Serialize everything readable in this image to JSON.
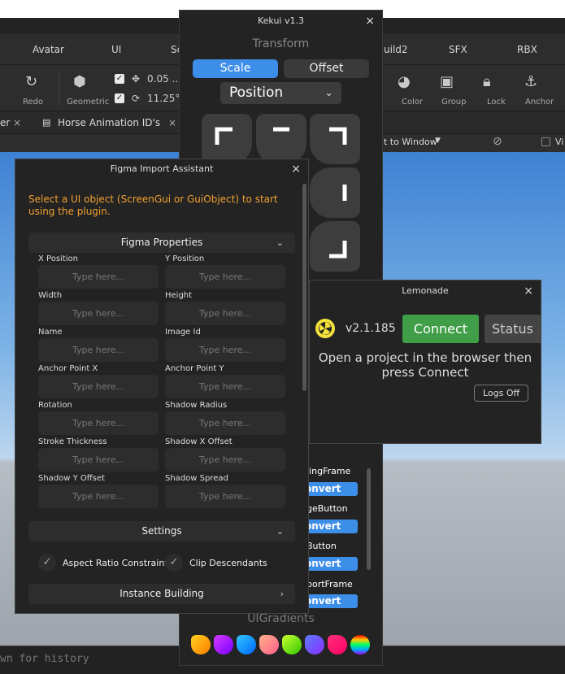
{
  "studio": {
    "tabs": [
      "Avatar",
      "UI",
      "Sc",
      "uild2",
      "SFX",
      "RBX"
    ],
    "ribbon": {
      "redo": "Redo",
      "geometric": "Geometric",
      "move_value": "0.05 ...",
      "rotate_value": "11.25°",
      "color": "Color",
      "group": "Group",
      "lock": "Lock",
      "anchor": "Anchor"
    },
    "doc_tabs": {
      "partial": "er",
      "horse": "Horse Animation ID's"
    },
    "view": {
      "fit": "t to Window",
      "vi": "Vi"
    },
    "command_placeholder": "wn for history"
  },
  "kekui": {
    "title": "Kekui v1.3",
    "transform_label": "Transform",
    "scale_label": "Scale",
    "offset_label": "Offset",
    "position_value": "Position",
    "list": [
      {
        "name": "lingFrame",
        "button": "onvert"
      },
      {
        "name": "geButton",
        "button": "onvert"
      },
      {
        "name": "Button",
        "button": "onvert"
      },
      {
        "name": "portFrame",
        "button": "onvert"
      }
    ],
    "uigradients_label": "UIGradients",
    "gradients": [
      "linear-gradient(135deg,#ffd21f,#ff7a00)",
      "linear-gradient(135deg,#d23bff,#7a00ff)",
      "linear-gradient(135deg,#30c8ff,#0066ff)",
      "linear-gradient(135deg,#ffb38a,#ff5c8a)",
      "linear-gradient(135deg,#c8ff30,#30c800)",
      "linear-gradient(135deg,#5a7bff,#8a30ff)",
      "linear-gradient(135deg,#ff3078,#ff0066)",
      "linear-gradient(180deg,#ff0000,#ffcc00,#00ff66,#00aaff,#aa00ff)"
    ]
  },
  "figma": {
    "title": "Figma Import Assistant",
    "notice": "Select a UI object (ScreenGui or GuiObject) to start using the plugin.",
    "properties_label": "Figma Properties",
    "placeholder": "Type here...",
    "fields": [
      "X Position",
      "Y Position",
      "Width",
      "Height",
      "Name",
      "Image Id",
      "Anchor Point X",
      "Anchor Point Y",
      "Rotation",
      "Shadow Radius",
      "Stroke Thickness",
      "Shadow X Offset",
      "Shadow Y Offset",
      "Shadow Spread"
    ],
    "settings_label": "Settings",
    "aspect_label": "Aspect Ratio Constraint",
    "clip_label": "Clip Descendants",
    "instance_label": "Instance Building"
  },
  "lemonade": {
    "title": "Lemonade",
    "version": "v2.1.185",
    "connect_label": "Connect",
    "status_label": "Status",
    "message": "Open a project in the browser then press Connect",
    "logs_label": "Logs Off"
  }
}
